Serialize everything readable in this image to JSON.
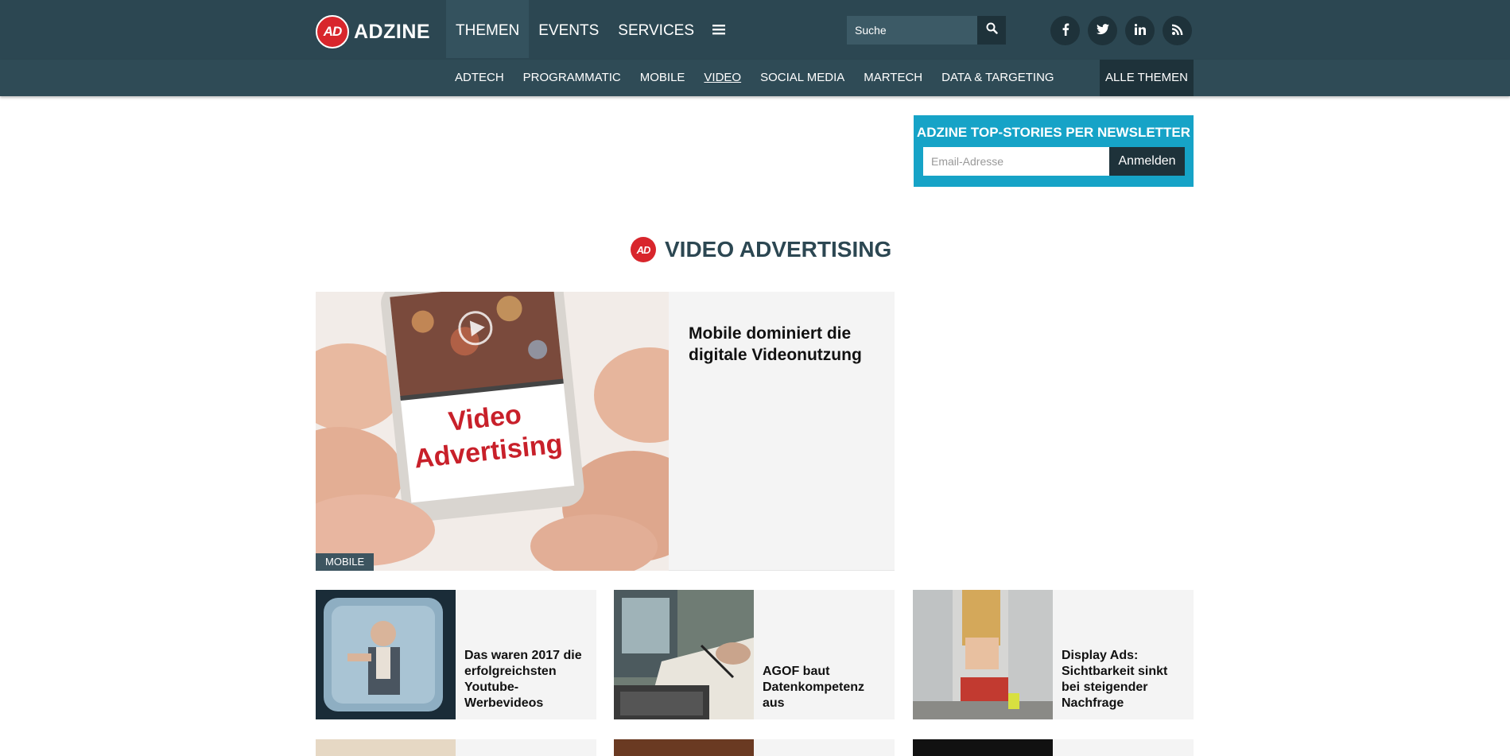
{
  "header": {
    "logo_mark": "AD",
    "logo_text": "ADZINE",
    "nav": [
      "THEMEN",
      "EVENTS",
      "SERVICES"
    ],
    "search_placeholder": "Suche"
  },
  "social": {
    "facebook": "f",
    "twitter": "t",
    "linkedin": "in",
    "rss": "rss"
  },
  "subnav": {
    "items": [
      "ADTECH",
      "PROGRAMMATIC",
      "MOBILE",
      "VIDEO",
      "SOCIAL MEDIA",
      "MARTECH",
      "DATA & TARGETING"
    ],
    "current": "VIDEO",
    "all_topics": "ALLE THEMEN"
  },
  "newsletter": {
    "title": "ADZINE TOP-STORIES PER NEWSLETTER",
    "placeholder": "Email-Adresse",
    "button": "Anmelden"
  },
  "section": {
    "badge": "AD",
    "title": "VIDEO ADVERTISING"
  },
  "featured": {
    "title": "Mobile dominiert die digitale Videonutzung",
    "tag": "MOBILE",
    "image_text_1": "Video",
    "image_text_2": "Advertising"
  },
  "articles": [
    {
      "title": "Das waren 2017 die erfolgreichsten Youtube-Werbevideos"
    },
    {
      "title": "AGOF baut Datenkompetenz aus"
    },
    {
      "title": "Display Ads: Sichtbarkeit sinkt bei steigender Nachfrage"
    }
  ],
  "colors": {
    "header_bg": "#2c4752",
    "accent_red": "#d8262c",
    "newsletter_bg": "#16a3c7"
  }
}
